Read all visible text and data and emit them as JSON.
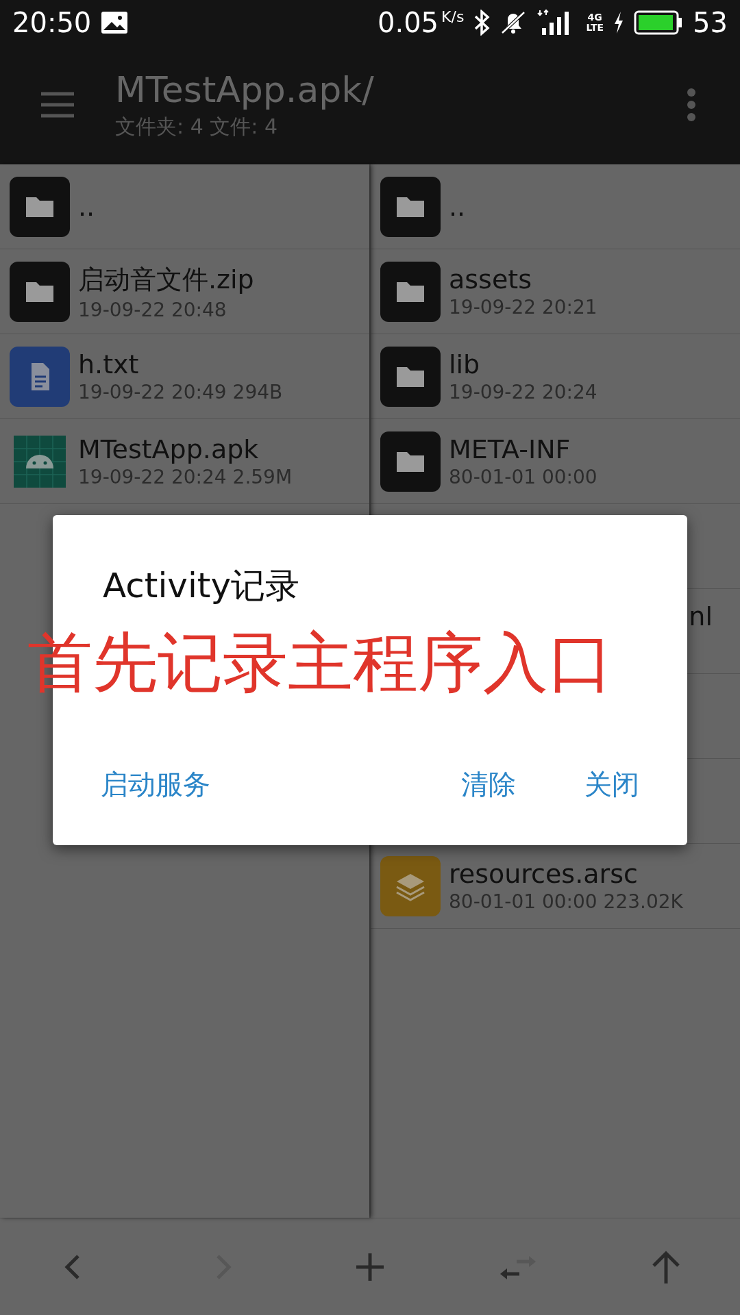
{
  "status_bar": {
    "time": "20:50",
    "speed": "0.05",
    "speed_unit": "K/s",
    "network": "4G",
    "network_sub": "LTE",
    "battery": "53"
  },
  "toolbar": {
    "title": "MTestApp.apk/",
    "subtitle": "文件夹: 4  文件: 4"
  },
  "left_pane": {
    "items": [
      {
        "kind": "parent",
        "name": ".."
      },
      {
        "kind": "folder",
        "name": "启动音文件.zip",
        "meta": "19-09-22 20:48"
      },
      {
        "kind": "text",
        "name": "h.txt",
        "meta": "19-09-22 20:49  294B"
      },
      {
        "kind": "apk",
        "name": "MTestApp.apk",
        "meta": "19-09-22 20:24  2.59M"
      }
    ]
  },
  "right_pane": {
    "items": [
      {
        "kind": "parent",
        "name": ".."
      },
      {
        "kind": "folder",
        "name": "assets",
        "meta": "19-09-22 20:21"
      },
      {
        "kind": "folder",
        "name": "lib",
        "meta": "19-09-22 20:24"
      },
      {
        "kind": "folder",
        "name": "META-INF",
        "meta": "80-01-01 00:00"
      },
      {
        "kind": "covered"
      },
      {
        "kind": "covered",
        "name": "nl"
      },
      {
        "kind": "covered"
      },
      {
        "kind": "covered"
      },
      {
        "kind": "archive",
        "name": "resources.arsc",
        "meta": "80-01-01 00:00  223.02K"
      }
    ]
  },
  "dialog": {
    "title": "Activity记录",
    "buttons": [
      "启动服务",
      "清除",
      "关闭"
    ]
  },
  "annotation": "首先记录主程序入口",
  "bottom_bar": [
    {
      "kind": "back",
      "disabled": false
    },
    {
      "kind": "forward",
      "disabled": true
    },
    {
      "kind": "add",
      "disabled": false
    },
    {
      "kind": "swap",
      "disabled": false
    },
    {
      "kind": "up",
      "disabled": false
    }
  ]
}
